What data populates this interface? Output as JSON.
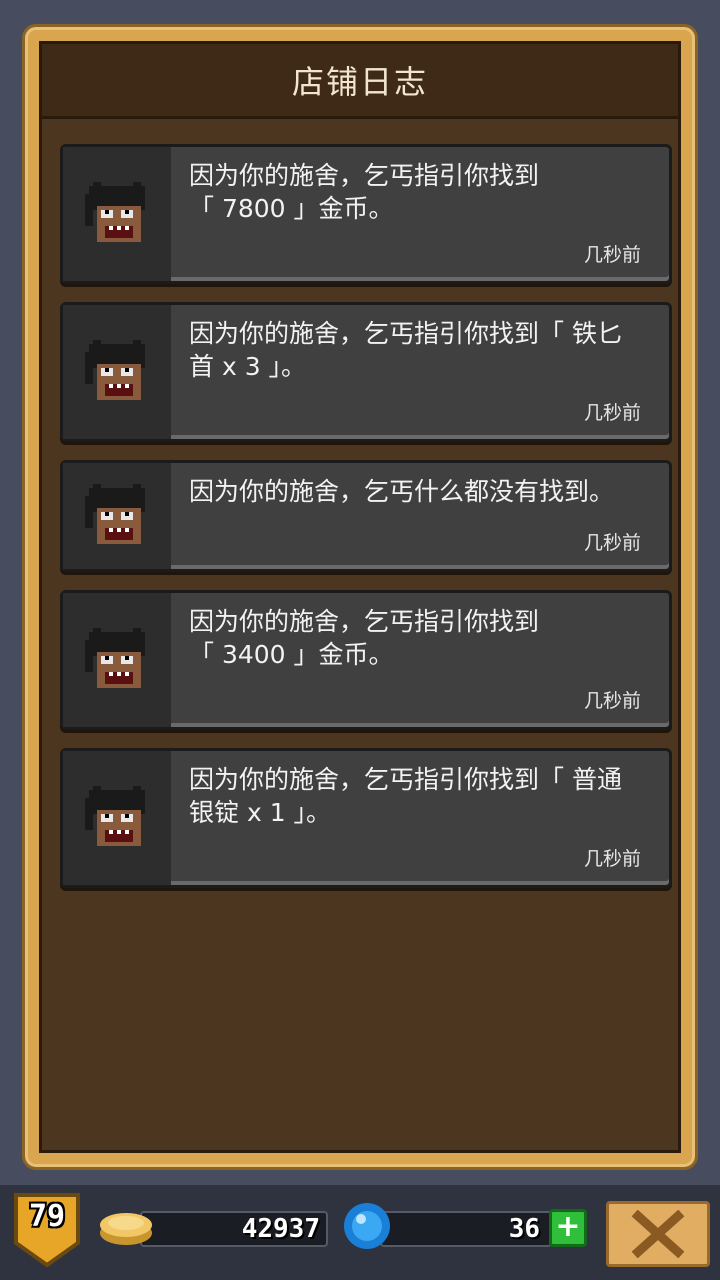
{
  "panel": {
    "title": "店铺日志"
  },
  "entries": [
    {
      "message": "因为你的施舍，乞丐指引你找到「 7800 」金币。",
      "line1": "因为你的施舍，乞丐指引你找到",
      "line2": "「 7800 」金币。",
      "time": "几秒前"
    },
    {
      "message": "因为你的施舍，乞丐指引你找到「 铁匕首 x 3 」。",
      "line1": "因为你的施舍，乞丐指引你找到「 铁匕",
      "line2": "首 x 3 」。",
      "time": "几秒前"
    },
    {
      "message": "因为你的施舍，乞丐什么都没有找到。",
      "line1": "因为你的施舍，乞丐什么都没有找到。",
      "line2": "",
      "time": "几秒前"
    },
    {
      "message": "因为你的施舍，乞丐指引你找到「 3400 」金币。",
      "line1": "因为你的施舍，乞丐指引你找到",
      "line2": "「 3400 」金币。",
      "time": "几秒前"
    },
    {
      "message": "因为你的施舍，乞丐指引你找到「 普通银锭 x 1 」。",
      "line1": "因为你的施舍，乞丐指引你找到「 普通",
      "line2": "银锭 x 1 」。",
      "time": "几秒前"
    }
  ],
  "bottom_bar": {
    "level": "79",
    "gold": "42937",
    "gems": "36"
  },
  "icons": {
    "portrait": "beggar-portrait-icon",
    "gold": "gold-coin-icon",
    "gem": "blue-gem-icon",
    "plus": "plus-icon",
    "close": "close-x-icon",
    "level": "level-shield-icon"
  },
  "colors": {
    "background": "#474c5e",
    "frame": "#d9a64f",
    "panel": "#4c3620",
    "entry": "#404040",
    "plus_green": "#2fbf3a"
  }
}
